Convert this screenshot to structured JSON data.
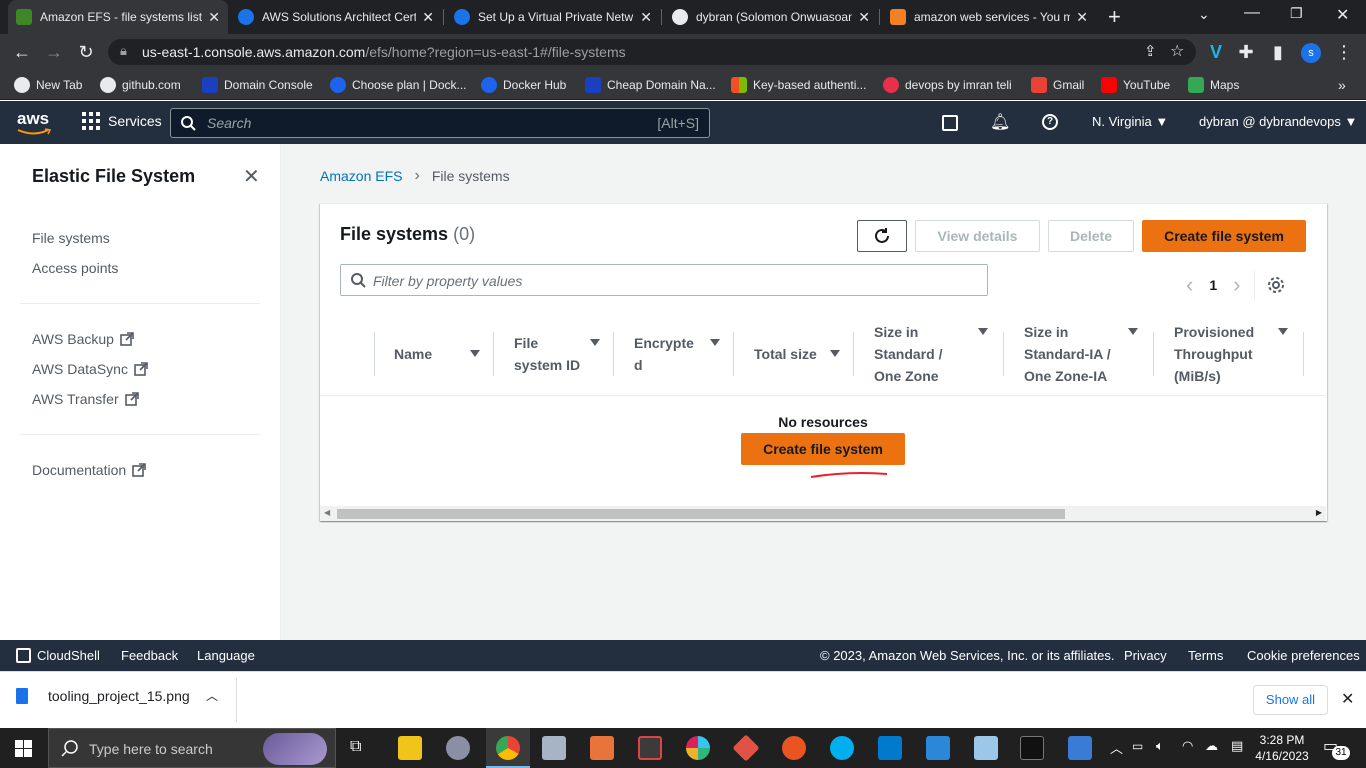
{
  "browser": {
    "tabs": [
      {
        "title": "Amazon EFS - file systems list",
        "color": "#3f8624",
        "active": true
      },
      {
        "title": "AWS Solutions Architect Certi",
        "color": "#1a73e8"
      },
      {
        "title": "Set Up a Virtual Private Netw",
        "color": "#1a73e8"
      },
      {
        "title": "dybran (Solomon Onwuasoan",
        "color": "#ffffff"
      },
      {
        "title": "amazon web services - You m",
        "color": "#ff5722"
      }
    ],
    "url_host": "us-east-1.console.aws.amazon.com",
    "url_path": "/efs/home?region=us-east-1#/file-systems",
    "profile_initial": "s",
    "bookmarks": [
      {
        "label": "New Tab",
        "color": "#ffffff"
      },
      {
        "label": "github.com",
        "color": "#ffffff"
      },
      {
        "label": "Domain Console",
        "color": "#1a3fbf"
      },
      {
        "label": "Choose plan | Dock...",
        "color": "#1d63ed"
      },
      {
        "label": "Docker Hub",
        "color": "#1d63ed"
      },
      {
        "label": "Cheap Domain Na...",
        "color": "#1a3fbf"
      },
      {
        "label": "Key-based authenti...",
        "color": "#f25022"
      },
      {
        "label": "devops by imran teli",
        "color": "#e8304a"
      },
      {
        "label": "Gmail",
        "color": "#ea4335"
      },
      {
        "label": "YouTube",
        "color": "#ff0000"
      },
      {
        "label": "Maps",
        "color": "#34a853"
      }
    ]
  },
  "aws_nav": {
    "logo": "aws",
    "services_label": "Services",
    "search_placeholder": "Search",
    "search_shortcut": "[Alt+S]",
    "region": "N. Virginia",
    "account": "dybran @ dybrandevops"
  },
  "sidebar": {
    "title": "Elastic File System",
    "group1": [
      "File systems",
      "Access points"
    ],
    "group2": [
      "AWS Backup",
      "AWS DataSync",
      "AWS Transfer"
    ],
    "group3": [
      "Documentation"
    ]
  },
  "breadcrumb": {
    "root": "Amazon EFS",
    "current": "File systems"
  },
  "panel": {
    "title": "File systems",
    "count": "(0)",
    "view_details": "View details",
    "delete": "Delete",
    "create": "Create file system",
    "filter_placeholder": "Filter by property values",
    "page": "1",
    "columns": [
      "Name",
      "File system ID",
      "Encrypte d",
      "Total size",
      "Size in Standard / One Zone",
      "Size in Standard-IA / One Zone-IA",
      "Provisioned Throughput (MiB/s)"
    ],
    "empty_text": "No resources",
    "empty_create": "Create file system"
  },
  "footer": {
    "cloudshell": "CloudShell",
    "feedback": "Feedback",
    "language": "Language",
    "copyright": "© 2023, Amazon Web Services, Inc. or its affiliates.",
    "privacy": "Privacy",
    "terms": "Terms",
    "cookie": "Cookie preferences"
  },
  "downloads": {
    "file": "tooling_project_15.png",
    "show_all": "Show all"
  },
  "taskbar": {
    "search_placeholder": "Type here to search",
    "time": "3:28 PM",
    "date": "4/16/2023",
    "notifications": "31"
  }
}
